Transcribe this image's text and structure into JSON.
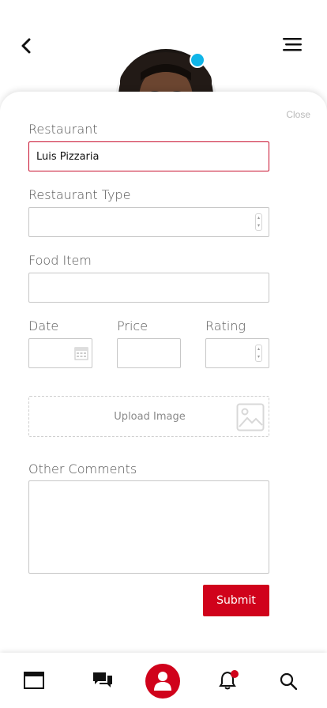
{
  "header": {
    "back_icon": "chevron-left-icon",
    "menu_icon": "hamburger-menu-icon",
    "avatar": "user-avatar-photo",
    "status_color": "#10b5e8"
  },
  "form": {
    "close_label": "Close",
    "restaurant": {
      "label": "Restaurant",
      "value": "Luis Pizzaria"
    },
    "restaurant_type": {
      "label": "Restaurant Type",
      "value": ""
    },
    "food_item": {
      "label": "Food Item",
      "value": ""
    },
    "date": {
      "label": "Date",
      "value": ""
    },
    "price": {
      "label": "Price",
      "value": ""
    },
    "rating": {
      "label": "Rating",
      "value": ""
    },
    "upload": {
      "label": "Upload Image",
      "icon": "image-icon"
    },
    "comments": {
      "label": "Other Comments",
      "value": ""
    },
    "submit_label": "Submit",
    "accent_color": "#d0021b"
  },
  "bottom_nav": {
    "items": [
      {
        "name": "browser-window-icon"
      },
      {
        "name": "chat-bubbles-icon"
      },
      {
        "name": "profile-icon",
        "active": true
      },
      {
        "name": "bell-icon",
        "badge": true
      },
      {
        "name": "search-icon"
      }
    ]
  }
}
